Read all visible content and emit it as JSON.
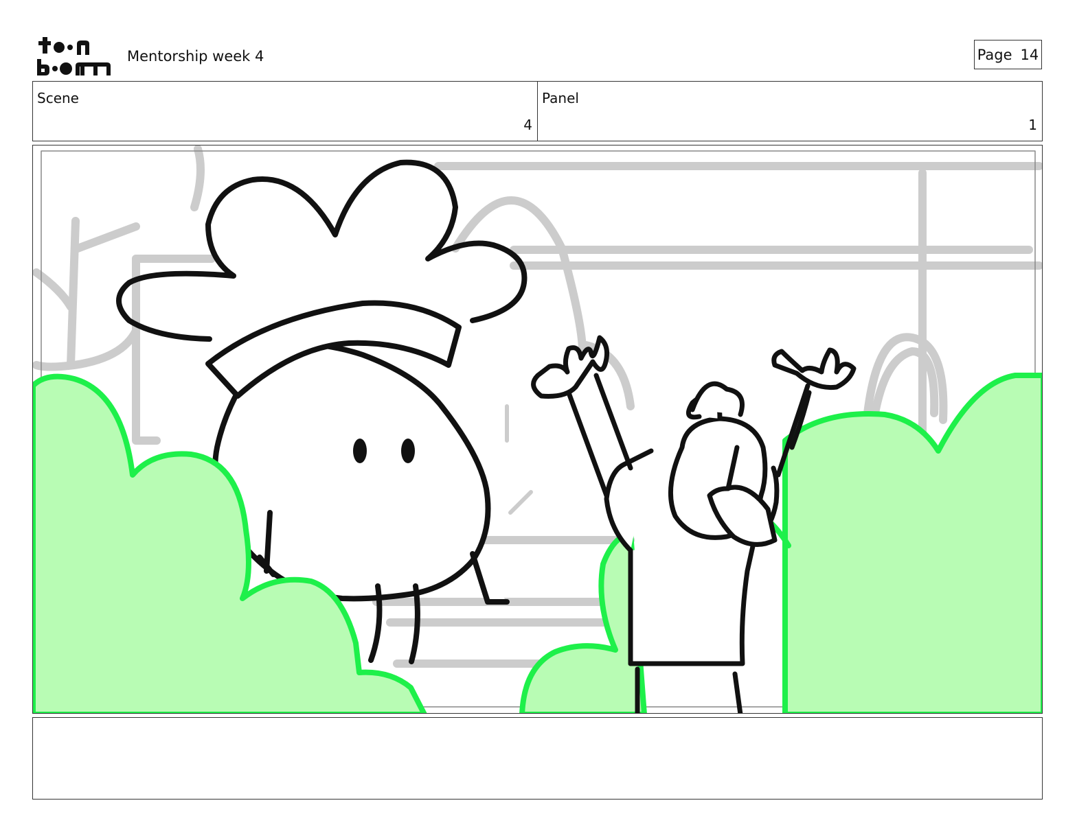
{
  "header": {
    "logo": {
      "top_text": "toon",
      "bottom_text": "boom",
      "icon": "toonboom-logo"
    },
    "title": "Mentorship week 4",
    "page_label": "Page",
    "page_number": "14"
  },
  "info": {
    "scene_label": "Scene",
    "scene_value": "4",
    "panel_label": "Panel",
    "panel_value": "1"
  },
  "panel_image": {
    "icon": "storyboard-drawing",
    "colors": {
      "bush_fill": "#b8fcb4",
      "bush_outline": "#1ef04a",
      "sketch_gray": "#cccccc",
      "ink": "#111111"
    }
  },
  "notes": {
    "text": ""
  }
}
